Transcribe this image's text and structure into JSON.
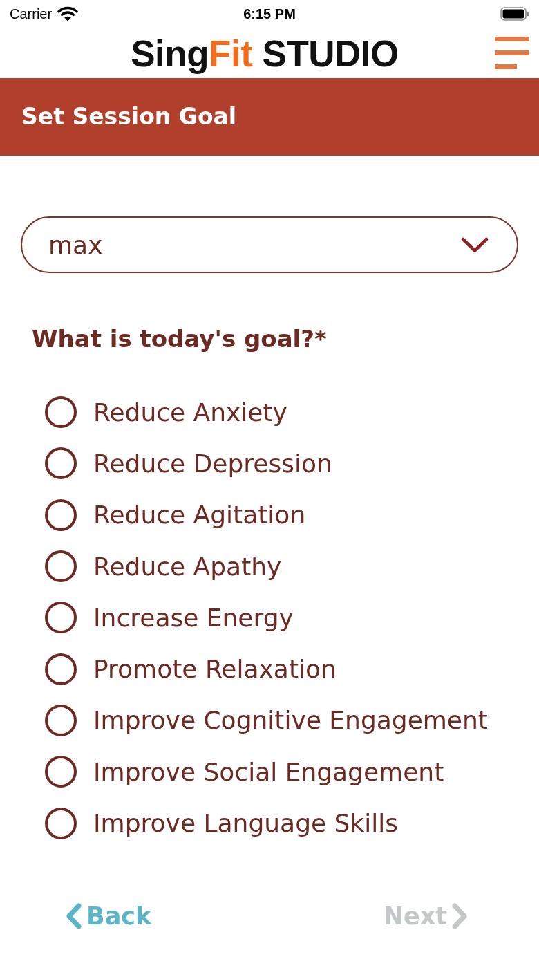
{
  "status_bar": {
    "carrier": "Carrier",
    "time": "6:15 PM"
  },
  "header": {
    "logo_words": [
      [
        {
          "text": "Sing",
          "kind": "plain"
        },
        {
          "text": "Fit",
          "kind": "accent"
        }
      ],
      [
        {
          "text": "STUDIO",
          "kind": "plain"
        }
      ]
    ]
  },
  "title_bar": {
    "title": "Set Session Goal"
  },
  "participant_select": {
    "value": "max"
  },
  "goal_question": {
    "label": "What is today's goal?*",
    "options": [
      {
        "label": "Reduce Anxiety",
        "selected": false
      },
      {
        "label": "Reduce Depression",
        "selected": false
      },
      {
        "label": "Reduce Agitation",
        "selected": false
      },
      {
        "label": "Reduce Apathy",
        "selected": false
      },
      {
        "label": "Increase Energy",
        "selected": false
      },
      {
        "label": "Promote Relaxation",
        "selected": false
      },
      {
        "label": "Improve Cognitive Engagement",
        "selected": false
      },
      {
        "label": "Improve Social Engagement",
        "selected": false
      },
      {
        "label": "Improve Language Skills",
        "selected": false
      }
    ]
  },
  "navigation": {
    "back": {
      "label": "Back",
      "disabled": false
    },
    "next": {
      "label": "Next",
      "disabled": true
    }
  }
}
